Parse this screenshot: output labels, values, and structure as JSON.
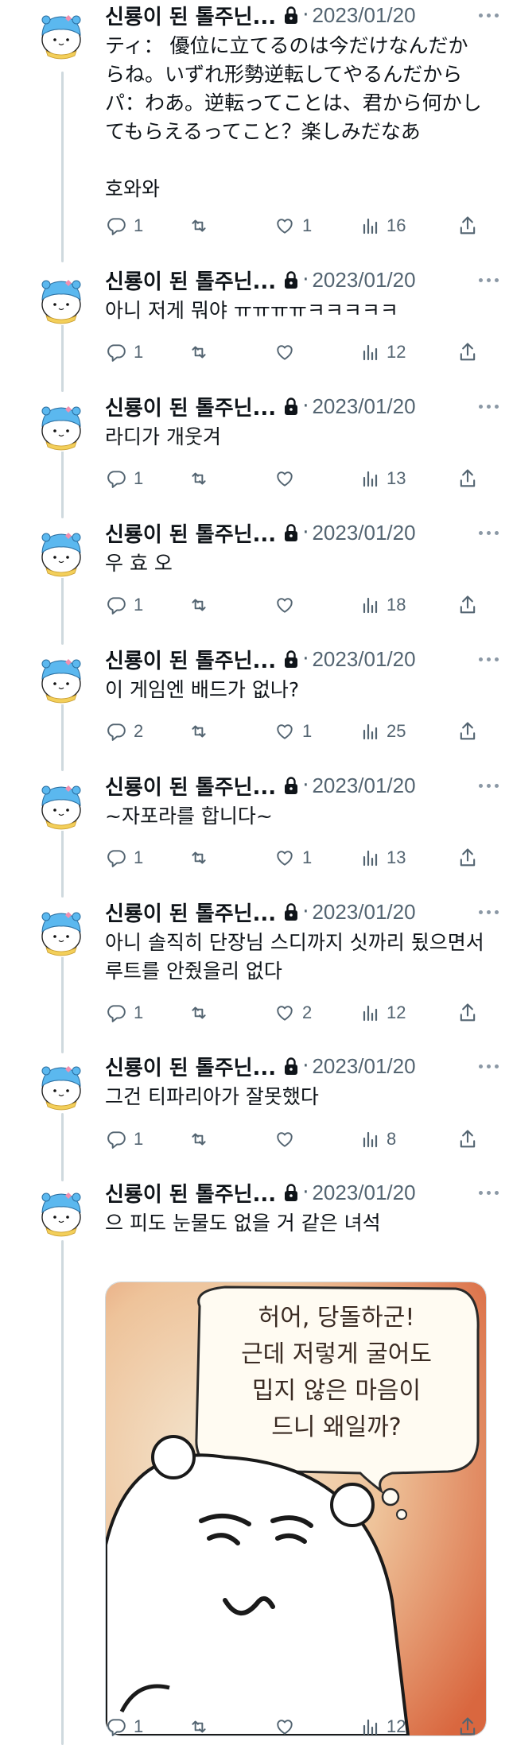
{
  "author": {
    "name": "신룡이 된 톨주닌...",
    "date": "2023/01/20",
    "dot": "·"
  },
  "tweets": [
    {
      "text": "ティ： 優位に立てるのは今だけなんだからね。いずれ形勢逆転してやるんだから\nパ：わあ。逆転ってことは、君から何かしてもらえるってこと？楽しみだなあ\n\n호와와",
      "replies": "1",
      "retweets": "",
      "likes": "1",
      "views": "16"
    },
    {
      "text": "아니 저게 뭐야 ㅠㅠㅠㅠㅋㅋㅋㅋㅋ",
      "replies": "1",
      "retweets": "",
      "likes": "",
      "views": "12"
    },
    {
      "text": "라디가 개웃겨",
      "replies": "1",
      "retweets": "",
      "likes": "",
      "views": "13"
    },
    {
      "text": "우 효 오",
      "replies": "1",
      "retweets": "",
      "likes": "",
      "views": "18"
    },
    {
      "text": "이 게임엔 배드가 없나?",
      "replies": "2",
      "retweets": "",
      "likes": "1",
      "views": "25"
    },
    {
      "text": "~자포라를 합니다~",
      "replies": "1",
      "retweets": "",
      "likes": "1",
      "views": "13"
    },
    {
      "text": "아니 솔직히 단장님 스디까지 싯까리 됬으면서 루트를 안줬을리 없다",
      "replies": "1",
      "retweets": "",
      "likes": "2",
      "views": "12"
    },
    {
      "text": "그건 티파리아가 잘못했다",
      "replies": "1",
      "retweets": "",
      "likes": "",
      "views": "8"
    },
    {
      "text": "으 피도 눈물도 없을 거 같은 녀석",
      "replies": "1",
      "retweets": "",
      "likes": "",
      "views": "12",
      "media": {
        "bubble_lines": [
          "허어, 당돌하군!",
          "근데 저렇게 굴어도",
          "밉지 않은 마음이",
          "드니 왜일까?"
        ]
      }
    }
  ],
  "icons": {
    "reply": "reply-icon",
    "retweet": "retweet-icon",
    "like": "like-icon",
    "views": "views-icon",
    "share": "share-icon",
    "lock": "lock-icon",
    "more": "more-icon"
  },
  "colors": {
    "text": "#0f1419",
    "muted": "#536471",
    "line": "#cfd9de",
    "avatar_blue": "#5bb8ef",
    "scarf": "#f3cf5a"
  }
}
